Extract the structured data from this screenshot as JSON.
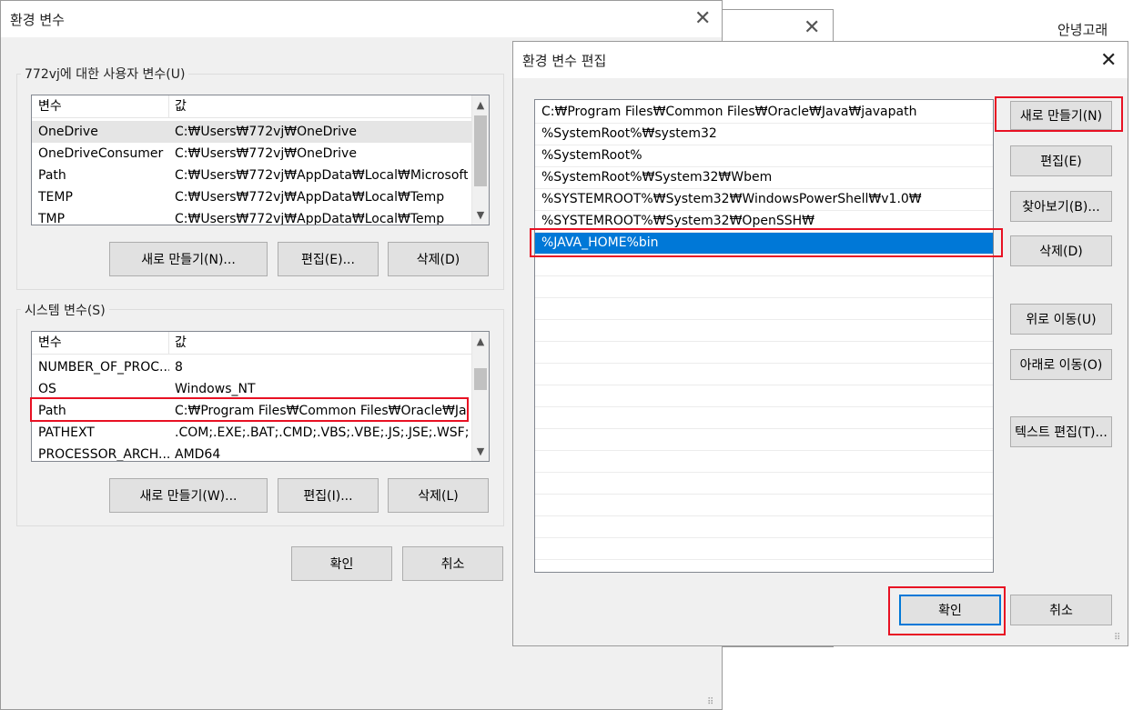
{
  "user_label": "안녕고래",
  "env_dialog": {
    "title": "환경 변수",
    "user_group": {
      "label": "772vj에 대한 사용자 변수(U)",
      "columns": [
        "변수",
        "값"
      ],
      "rows": [
        {
          "name": "OneDrive",
          "value": "C:₩Users₩772vj₩OneDrive"
        },
        {
          "name": "OneDriveConsumer",
          "value": "C:₩Users₩772vj₩OneDrive"
        },
        {
          "name": "Path",
          "value": "C:₩Users₩772vj₩AppData₩Local₩Microsoft..."
        },
        {
          "name": "TEMP",
          "value": "C:₩Users₩772vj₩AppData₩Local₩Temp"
        },
        {
          "name": "TMP",
          "value": "C:₩Users₩772vj₩AppData₩Local₩Temp"
        }
      ],
      "selected_index": 0,
      "buttons": {
        "new": "새로 만들기(N)...",
        "edit": "편집(E)...",
        "delete": "삭제(D)"
      }
    },
    "system_group": {
      "label": "시스템 변수(S)",
      "columns": [
        "변수",
        "값"
      ],
      "rows": [
        {
          "name": "NUMBER_OF_PROC...",
          "value": "8"
        },
        {
          "name": "OS",
          "value": "Windows_NT"
        },
        {
          "name": "Path",
          "value": "C:₩Program Files₩Common Files₩Oracle₩Ja..."
        },
        {
          "name": "PATHEXT",
          "value": ".COM;.EXE;.BAT;.CMD;.VBS;.VBE;.JS;.JSE;.WSF;...."
        },
        {
          "name": "PROCESSOR_ARCH...",
          "value": "AMD64"
        }
      ],
      "highlighted_index": 2,
      "buttons": {
        "new": "새로 만들기(W)...",
        "edit": "편집(I)...",
        "delete": "삭제(L)"
      }
    },
    "ok": "확인",
    "cancel": "취소"
  },
  "edit_dialog": {
    "title": "환경 변수 편집",
    "entries": [
      "C:₩Program Files₩Common Files₩Oracle₩Java₩javapath",
      "%SystemRoot%₩system32",
      "%SystemRoot%",
      "%SystemRoot%₩System32₩Wbem",
      "%SYSTEMROOT%₩System32₩WindowsPowerShell₩v1.0₩",
      "%SYSTEMROOT%₩System32₩OpenSSH₩",
      "%JAVA_HOME%bin"
    ],
    "selected_index": 6,
    "buttons": {
      "new": "새로 만들기(N)",
      "edit": "편집(E)",
      "browse": "찾아보기(B)...",
      "delete": "삭제(D)",
      "move_up": "위로 이동(U)",
      "move_down": "아래로 이동(O)",
      "edit_text": "텍스트 편집(T)..."
    },
    "ok": "확인",
    "cancel": "취소"
  },
  "colors": {
    "highlight": "#e81123",
    "selection": "#0078d7"
  }
}
